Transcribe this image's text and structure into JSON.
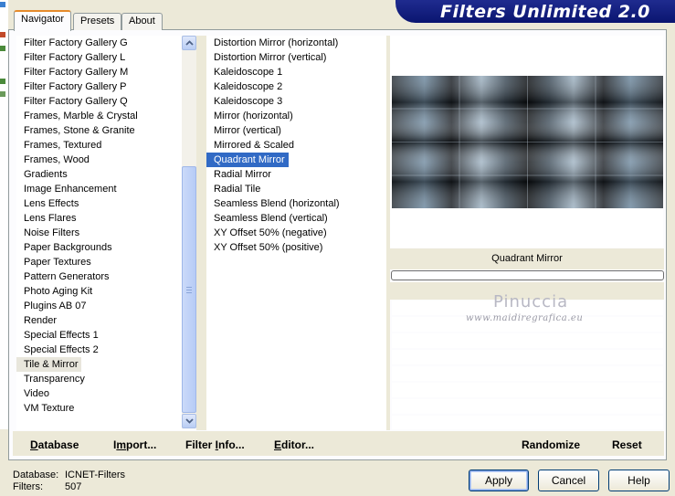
{
  "title": "Filters Unlimited 2.0",
  "tabs": [
    {
      "label": "Navigator",
      "active": true
    },
    {
      "label": "Presets",
      "active": false
    },
    {
      "label": "About",
      "active": false
    }
  ],
  "categories": [
    "Filter Factory Gallery G",
    "Filter Factory Gallery L",
    "Filter Factory Gallery M",
    "Filter Factory Gallery P",
    "Filter Factory Gallery Q",
    "Frames, Marble & Crystal",
    "Frames, Stone & Granite",
    "Frames, Textured",
    "Frames, Wood",
    "Gradients",
    "Image Enhancement",
    "Lens Effects",
    "Lens Flares",
    "Noise Filters",
    "Paper Backgrounds",
    "Paper Textures",
    "Pattern Generators",
    "Photo Aging Kit",
    "Plugins AB 07",
    "Render",
    "Special Effects 1",
    "Special Effects 2",
    "Tile & Mirror",
    "Transparency",
    "Video",
    "VM Texture"
  ],
  "selected_category": "Tile & Mirror",
  "filters": [
    "Distortion Mirror (horizontal)",
    "Distortion Mirror (vertical)",
    "Kaleidoscope 1",
    "Kaleidoscope 2",
    "Kaleidoscope 3",
    "Mirror (horizontal)",
    "Mirror (vertical)",
    "Mirrored & Scaled",
    "Quadrant Mirror",
    "Radial Mirror",
    "Radial Tile",
    "Seamless Blend (horizontal)",
    "Seamless Blend (vertical)",
    "XY Offset 50% (negative)",
    "XY Offset 50% (positive)"
  ],
  "selected_filter": "Quadrant Mirror",
  "preview_label": "Quadrant Mirror",
  "watermark": {
    "name": "Pinuccia",
    "site": "www.maidiregrafica.eu"
  },
  "actions": {
    "database": {
      "u": "D",
      "rest": "atabase"
    },
    "import": {
      "pre": "I",
      "u": "m",
      "rest": "port..."
    },
    "filter_info": {
      "pre": "Filter ",
      "u": "I",
      "rest": "nfo..."
    },
    "editor": {
      "u": "E",
      "rest": "ditor..."
    },
    "randomize": "Randomize",
    "reset": "Reset"
  },
  "info": {
    "database_label": "Database:",
    "database_value": "ICNET-Filters",
    "filters_label": "Filters:",
    "filters_value": "507"
  },
  "buttons": {
    "apply": "Apply",
    "cancel": "Cancel",
    "help": "Help"
  },
  "colors": {
    "banner": "#0f1b78",
    "selection": "#316ac5",
    "face": "#ece9d8"
  }
}
